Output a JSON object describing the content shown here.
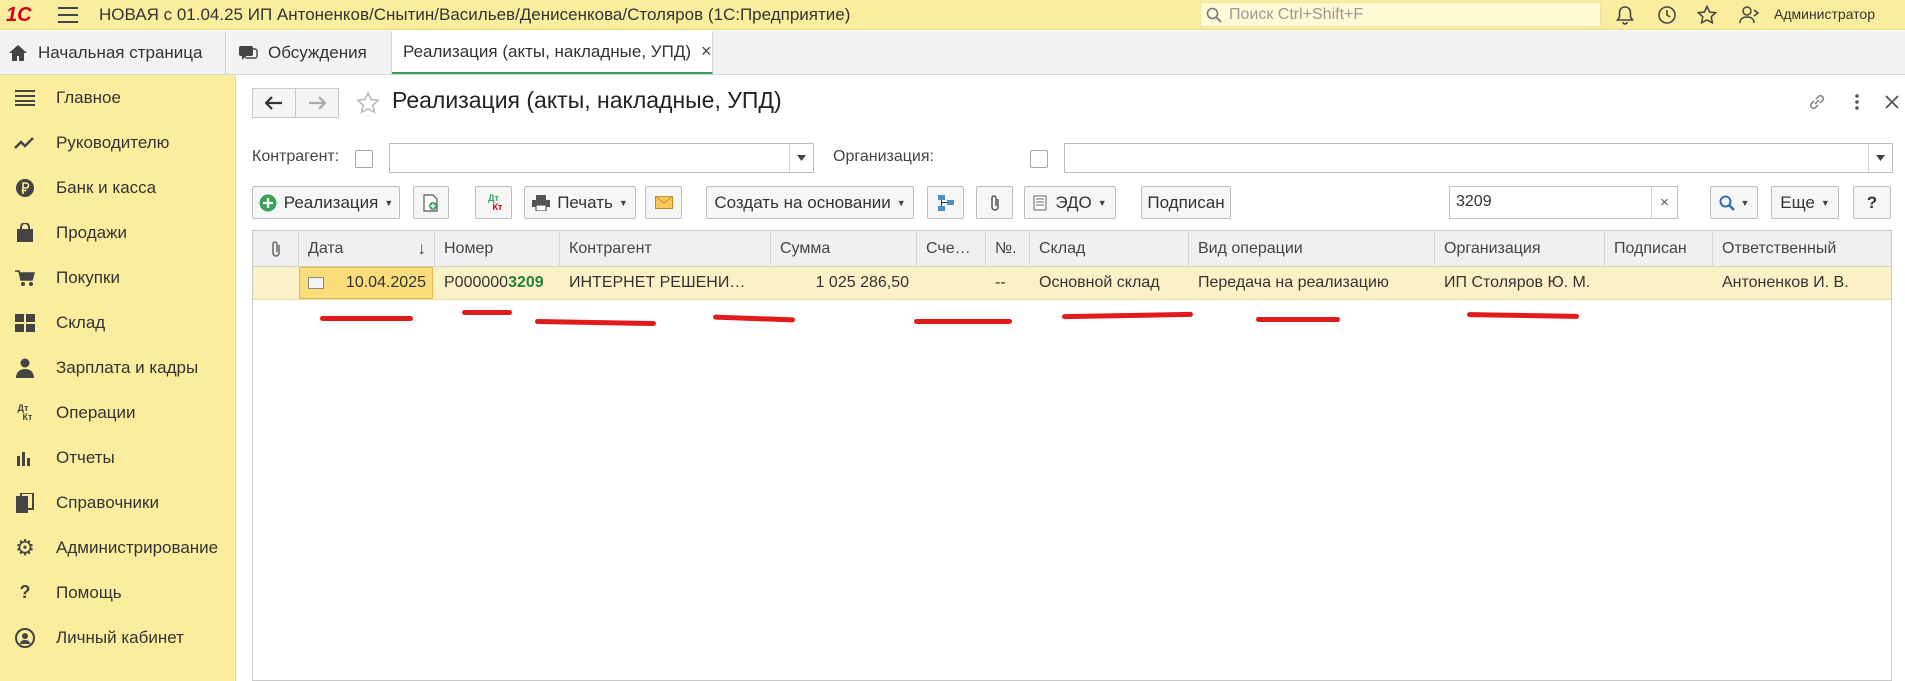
{
  "app": {
    "title": "НОВАЯ с 01.04.25 ИП Антоненков/Снытин/Васильев/Денисенкова/Столяров  (1С:Предприятие)",
    "logo": "1С",
    "search_placeholder": "Поиск Ctrl+Shift+F",
    "user": "Администратор",
    "brand_color": "#fbed9e"
  },
  "tabs": [
    {
      "label": "Начальная страница",
      "icon": "home-icon"
    },
    {
      "label": "Обсуждения",
      "icon": "chat-icon"
    },
    {
      "label": "Реализация (акты, накладные, УПД)",
      "icon": "close-icon",
      "active": true
    }
  ],
  "sidebar": {
    "items": [
      {
        "label": "Главное",
        "icon": "menu-lines-icon"
      },
      {
        "label": "Руководителю",
        "icon": "trend-icon"
      },
      {
        "label": "Банк и касса",
        "icon": "ruble-icon"
      },
      {
        "label": "Продажи",
        "icon": "bag-icon"
      },
      {
        "label": "Покупки",
        "icon": "cart-icon"
      },
      {
        "label": "Склад",
        "icon": "warehouse-icon"
      },
      {
        "label": "Зарплата и кадры",
        "icon": "person-icon"
      },
      {
        "label": "Операции",
        "icon": "dt-kt-icon"
      },
      {
        "label": "Отчеты",
        "icon": "bar-chart-icon"
      },
      {
        "label": "Справочники",
        "icon": "books-icon"
      },
      {
        "label": "Администрирование",
        "icon": "gear-icon"
      },
      {
        "label": "Помощь",
        "icon": "question-icon"
      },
      {
        "label": "Личный кабинет",
        "icon": "account-icon"
      }
    ]
  },
  "form": {
    "title": "Реализация (акты, накладные, УПД)",
    "filters": {
      "counterparty_label": "Контрагент:",
      "organization_label": "Организация:"
    },
    "toolbar": {
      "create_label": "Реализация",
      "dtkt_label": "Дт Кт",
      "print_label": "Печать",
      "based_on_label": "Создать на основании",
      "edo_label": "ЭДО",
      "signed_label": "Подписан",
      "search_value": "3209",
      "more_label": "Еще",
      "help_label": "?"
    },
    "table": {
      "columns": [
        "Дата",
        "Номер",
        "Контрагент",
        "Сумма",
        "Сче…",
        "№.",
        "Склад",
        "Вид операции",
        "Организация",
        "Подписан",
        "Ответственный"
      ],
      "rows": [
        {
          "date": "10.04.2025",
          "number_prefix": "Р000000",
          "number_match": "3209",
          "counterparty": "ИНТЕРНЕТ РЕШЕНИ…",
          "sum": "1 025 286,50",
          "invoice": "",
          "no": "--",
          "warehouse": "Основной склад",
          "operation": "Передача на реализацию",
          "organization": "ИП Столяров Ю. М.",
          "signed": "",
          "responsible": "Антоненков И. В."
        }
      ]
    }
  }
}
